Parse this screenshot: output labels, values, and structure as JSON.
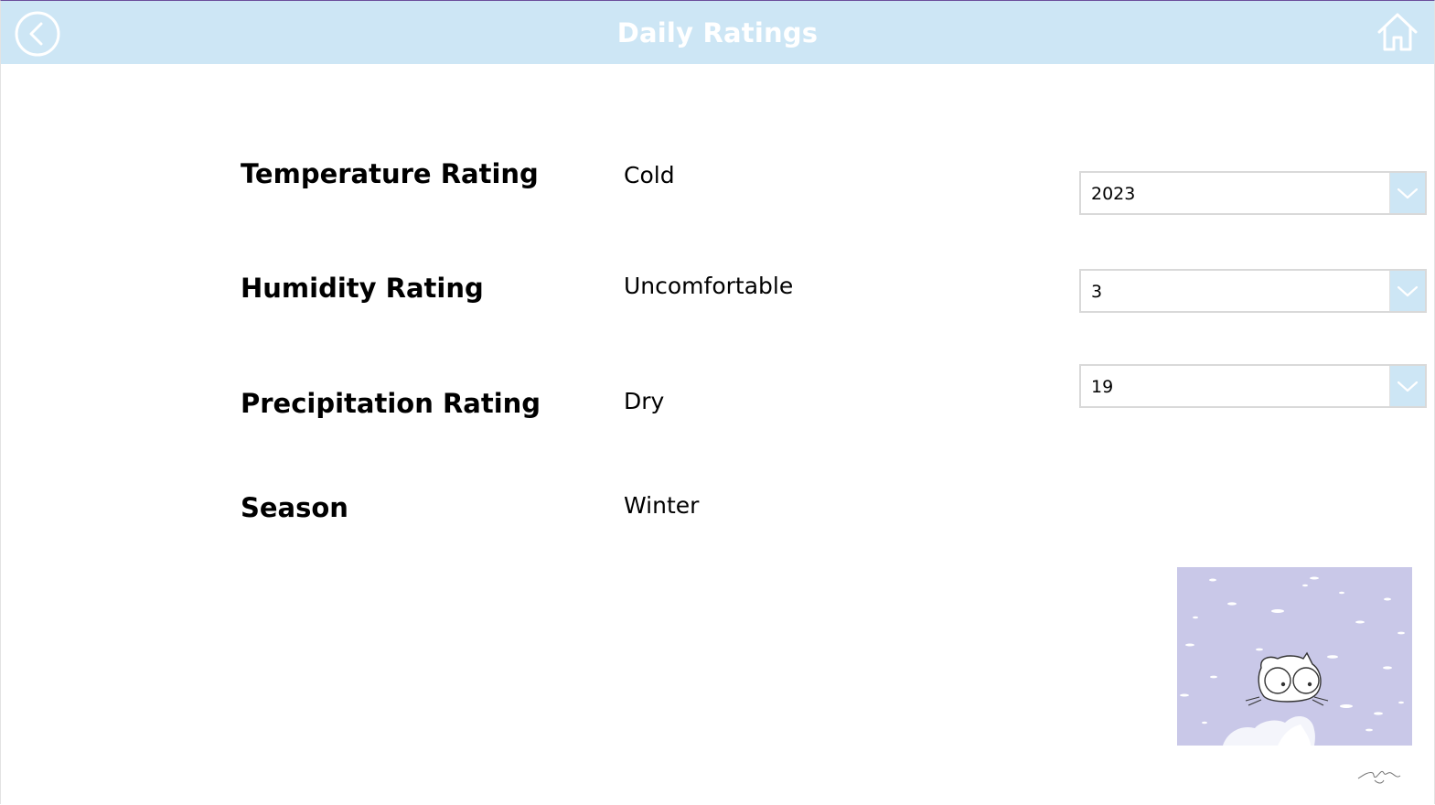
{
  "header": {
    "title": "Daily Ratings",
    "back_icon": "chevron-left-circle-icon",
    "home_icon": "home-icon",
    "background_color": "#cde6f5"
  },
  "ratings": [
    {
      "label": "Temperature Rating",
      "value": "Cold"
    },
    {
      "label": "Humidity Rating",
      "value": "Uncomfortable"
    },
    {
      "label": "Precipitation Rating",
      "value": "Dry"
    },
    {
      "label": "Season",
      "value": "Winter"
    }
  ],
  "dropdowns": [
    {
      "selected": "2023"
    },
    {
      "selected": "3"
    },
    {
      "selected": "19"
    }
  ],
  "illustration": {
    "description_icon": "snowy-cat-illustration",
    "background_color": "#c9c8e8"
  },
  "signature_icon": "artist-signature"
}
